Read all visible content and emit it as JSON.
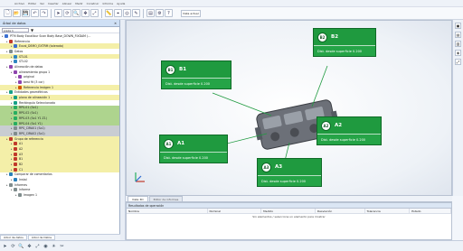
{
  "menubar": {
    "items": [
      "Archivo",
      "Editar",
      "Ver",
      "Insertar",
      "Alinear",
      "Medir",
      "Construir",
      "Informe",
      "Ayuda"
    ]
  },
  "toolbar": {
    "buttons": [
      "new-file-icon",
      "open-icon",
      "save-icon",
      "undo-icon",
      "redo-icon",
      "select-icon",
      "rotate-icon",
      "zoom-icon",
      "pan-icon",
      "fit-icon",
      "measure-icon",
      "align-icon",
      "scan-icon",
      "probe-icon",
      "report-icon",
      "settings-icon",
      "help-icon"
    ],
    "select_value": "Vista actual"
  },
  "left_panel": {
    "title": "Árbol de datos",
    "combo_value": "pieza 1",
    "rows": [
      {
        "label": "PTM Body Excalibur Scan Body Base_DOWN_FIXDAM (…",
        "hl": "",
        "indent": 0,
        "icon": "#3b6fd1"
      },
      {
        "label": "Referencia",
        "hl": "",
        "indent": 1,
        "icon": "#c0392b"
      },
      {
        "label": "Excal_DEMO_EXTRM (tolerada)",
        "hl": "yellow",
        "indent": 2,
        "icon": "#3b6fd1"
      },
      {
        "label": "Datos",
        "hl": "",
        "indent": 1,
        "icon": "#7f8c8d"
      },
      {
        "label": "STL01",
        "hl": "yellow",
        "indent": 2,
        "icon": "#2e86c1"
      },
      {
        "label": "STL02",
        "hl": "",
        "indent": 2,
        "icon": "#2e86c1"
      },
      {
        "label": "Alineación de datos",
        "hl": "",
        "indent": 1,
        "icon": "#8e44ad"
      },
      {
        "label": "alineamiento grupo 1",
        "hl": "",
        "indent": 2,
        "icon": "#8e44ad"
      },
      {
        "label": "original",
        "hl": "",
        "indent": 3,
        "icon": "#8e44ad"
      },
      {
        "label": "best fit (3 cor)",
        "hl": "",
        "indent": 3,
        "icon": "#8e44ad"
      },
      {
        "label": "Referencia Imágen 1",
        "hl": "yellow",
        "indent": 3,
        "icon": "#d35400"
      },
      {
        "label": "Entidades geométricas",
        "hl": "",
        "indent": 1,
        "icon": "#16a085"
      },
      {
        "label": "plano de alineación 1",
        "hl": "yellow",
        "indent": 2,
        "icon": "#16a085"
      },
      {
        "label": "Rectángulo Seleccionado",
        "hl": "",
        "indent": 2,
        "icon": "#16a085"
      },
      {
        "label": "RPS-01 (Sx1)",
        "hl": "green",
        "indent": 2,
        "icon": "#27ae60"
      },
      {
        "label": "RPS-02 (Sx1)",
        "hl": "green",
        "indent": 2,
        "icon": "#27ae60"
      },
      {
        "label": "RPS-03 (Sx1 Y1 Z1)",
        "hl": "green",
        "indent": 2,
        "icon": "#27ae60"
      },
      {
        "label": "RPS-04 (Sx1 Y1)",
        "hl": "green",
        "indent": 2,
        "icon": "#27ae60"
      },
      {
        "label": "RPS_CIRA01 (Sx1)",
        "hl": "gray",
        "indent": 2,
        "icon": "#7f8c8d"
      },
      {
        "label": "RPS_CIRA02 (Sx1)",
        "hl": "gray",
        "indent": 2,
        "icon": "#7f8c8d"
      },
      {
        "label": "Grupo de referencia",
        "hl": "yellow",
        "indent": 1,
        "icon": "#c0392b"
      },
      {
        "label": "A1",
        "hl": "yellow",
        "indent": 2,
        "icon": "#c0392b"
      },
      {
        "label": "A2",
        "hl": "yellow",
        "indent": 2,
        "icon": "#c0392b"
      },
      {
        "label": "A3",
        "hl": "yellow",
        "indent": 2,
        "icon": "#c0392b"
      },
      {
        "label": "B1",
        "hl": "yellow",
        "indent": 2,
        "icon": "#c0392b"
      },
      {
        "label": "B2",
        "hl": "yellow",
        "indent": 2,
        "icon": "#c0392b"
      },
      {
        "label": "C1",
        "hl": "yellow",
        "indent": 2,
        "icon": "#c0392b"
      },
      {
        "label": "Comparar de comentarios",
        "hl": "",
        "indent": 1,
        "icon": "#2980b9"
      },
      {
        "label": "Instal",
        "hl": "",
        "indent": 2,
        "icon": "#2980b9"
      },
      {
        "label": "Informes",
        "hl": "",
        "indent": 1,
        "icon": "#7f8c8d"
      },
      {
        "label": "Informe",
        "hl": "",
        "indent": 2,
        "icon": "#7f8c8d"
      },
      {
        "label": "Imagen 1",
        "hl": "",
        "indent": 3,
        "icon": "#7f8c8d"
      }
    ],
    "bottom_tabs": [
      "Árbol de datos",
      "Árbol de Datos"
    ]
  },
  "labels": [
    {
      "id": "B2",
      "title": "B2",
      "sub": "Dist. desde superficie 0.200"
    },
    {
      "id": "B1",
      "title": "B1",
      "sub": "Dist. desde superficie 0.200"
    },
    {
      "id": "A2",
      "title": "A2",
      "sub": "Dist. desde superficie 0.200"
    },
    {
      "id": "A1",
      "title": "A1",
      "sub": "Dist. desde superficie 0.200"
    },
    {
      "id": "A3",
      "title": "A3",
      "sub": "Dist. desde superficie 0.200"
    }
  ],
  "viewport_tabs": [
    "Vista 3D",
    "Editor de informes"
  ],
  "bottom_panel": {
    "title": "Resultados de operación",
    "columns": [
      "Nombre",
      "Nominal",
      "Medido",
      "Desviación",
      "Tolerancia",
      "Estado"
    ],
    "empty_text": "Sin elementos / seleccione un elemento para mostrar"
  },
  "statusbar": {
    "buttons": [
      "select-icon",
      "rotate-icon",
      "zoom-icon",
      "pan-icon",
      "fit-icon",
      "view-icon",
      "light-icon",
      "section-icon"
    ]
  }
}
